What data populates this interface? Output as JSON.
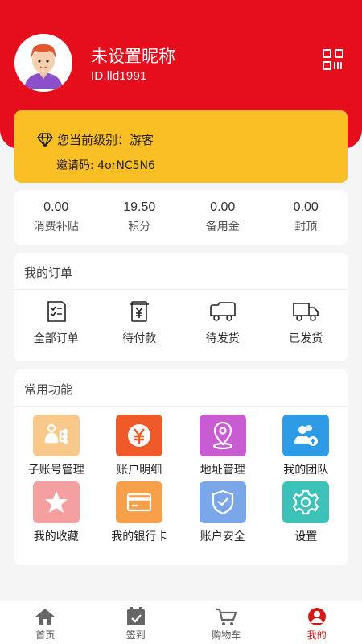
{
  "profile": {
    "nickname": "未设置昵称",
    "id": "ID.lld1991"
  },
  "level": {
    "label": "您当前级别：游客",
    "invite": "邀请码: 4orNC5N6"
  },
  "stats": [
    {
      "value": "0.00",
      "label": "消费补贴"
    },
    {
      "value": "19.50",
      "label": "积分"
    },
    {
      "value": "0.00",
      "label": "备用金"
    },
    {
      "value": "0.00",
      "label": "封顶"
    }
  ],
  "orders": {
    "title": "我的订单",
    "items": [
      {
        "label": "全部订单",
        "icon": "order-list-icon"
      },
      {
        "label": "待付款",
        "icon": "payment-pending-icon"
      },
      {
        "label": "待发货",
        "icon": "truck-icon"
      },
      {
        "label": "已发货",
        "icon": "shipped-truck-icon"
      }
    ]
  },
  "functions": {
    "title": "常用功能",
    "items": [
      {
        "label": "子账号管理",
        "icon": "sub-account-icon",
        "color": "#f8c98a"
      },
      {
        "label": "账户明细",
        "icon": "yuan-icon",
        "color": "#f05a28"
      },
      {
        "label": "地址管理",
        "icon": "location-pin-icon",
        "color": "#c95bd3"
      },
      {
        "label": "我的团队",
        "icon": "team-icon",
        "color": "#2e9be6"
      },
      {
        "label": "我的收藏",
        "icon": "star-icon",
        "color": "#f4a0a0"
      },
      {
        "label": "我的银行卡",
        "icon": "bank-card-icon",
        "color": "#f6a04a"
      },
      {
        "label": "账户安全",
        "icon": "shield-icon",
        "color": "#7ba7e8"
      },
      {
        "label": "设置",
        "icon": "gear-icon",
        "color": "#3cc2b8"
      }
    ]
  },
  "tabbar": [
    {
      "label": "首页",
      "icon": "home-icon"
    },
    {
      "label": "签到",
      "icon": "calendar-icon"
    },
    {
      "label": "购物车",
      "icon": "cart-icon"
    },
    {
      "label": "我的",
      "icon": "user-icon",
      "active": true
    }
  ],
  "colors": {
    "header": "#e60d1d",
    "level_card": "#fbbf26",
    "active_tab": "#d61a1a"
  }
}
